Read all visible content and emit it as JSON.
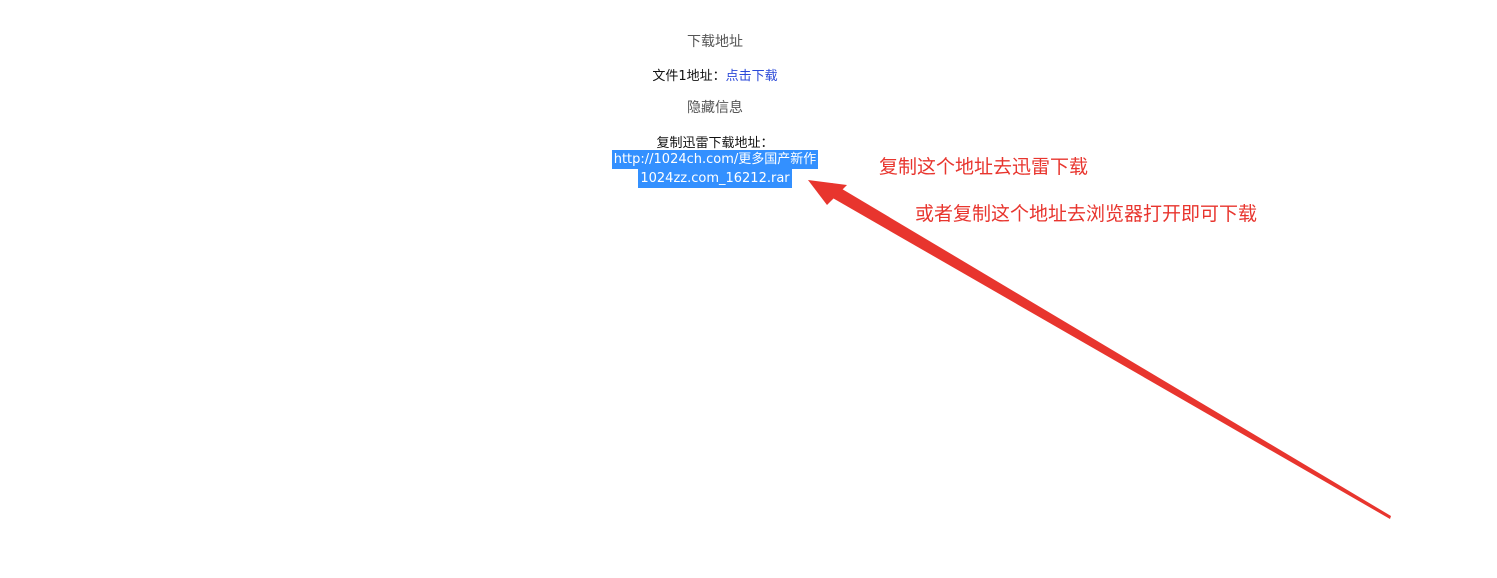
{
  "download_section": {
    "heading": "下载地址",
    "file1_label": "文件1地址：",
    "file1_link": "点击下载"
  },
  "hidden_section": {
    "heading": "隐藏信息",
    "thunder_label": "复制迅雷下载地址：",
    "thunder_url_line1": "http://1024ch.com/更多国产新作",
    "thunder_url_line2": "1024zz.com_16212.rar"
  },
  "annotations": {
    "copy_to_thunder": "复制这个地址去迅雷下载",
    "copy_to_browser": "或者复制这个地址去浏览器打开即可下载"
  },
  "colors": {
    "annotation": "#e8352e",
    "selection": "#3390ff",
    "link": "#2b49d8"
  }
}
